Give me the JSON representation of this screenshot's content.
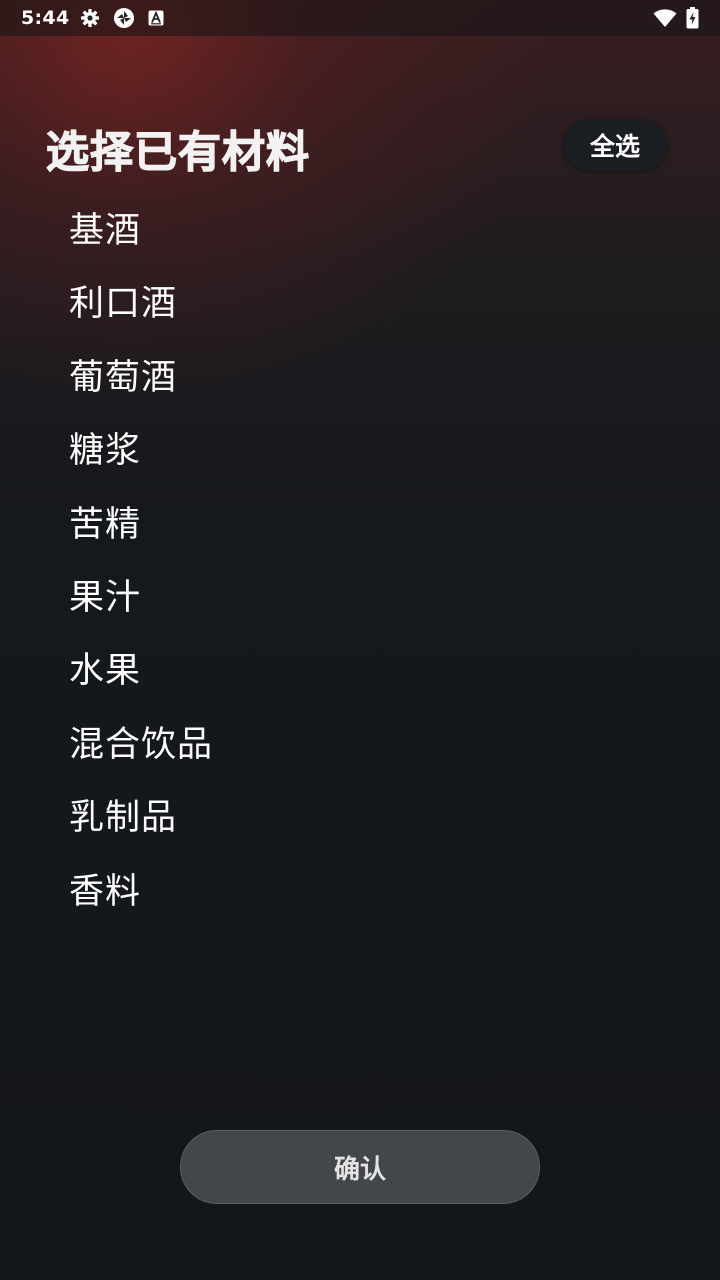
{
  "status_bar": {
    "time": "5:44",
    "left_icons": [
      "settings-gear-icon",
      "shutter-app-icon",
      "keyboard-a-icon"
    ],
    "right_icons": [
      "wifi-icon",
      "battery-charging-icon"
    ]
  },
  "header": {
    "title": "选择已有材料",
    "select_all_label": "全选"
  },
  "ingredients": [
    "基酒",
    "利口酒",
    "葡萄酒",
    "糖浆",
    "苦精",
    "果汁",
    "水果",
    "混合饮品",
    "乳制品",
    "香料"
  ],
  "footer": {
    "confirm_label": "确认"
  },
  "colors": {
    "background": "#14171b",
    "header_glow": "#6e2422",
    "text": "#ffffff",
    "button_bg": "#43474b"
  }
}
